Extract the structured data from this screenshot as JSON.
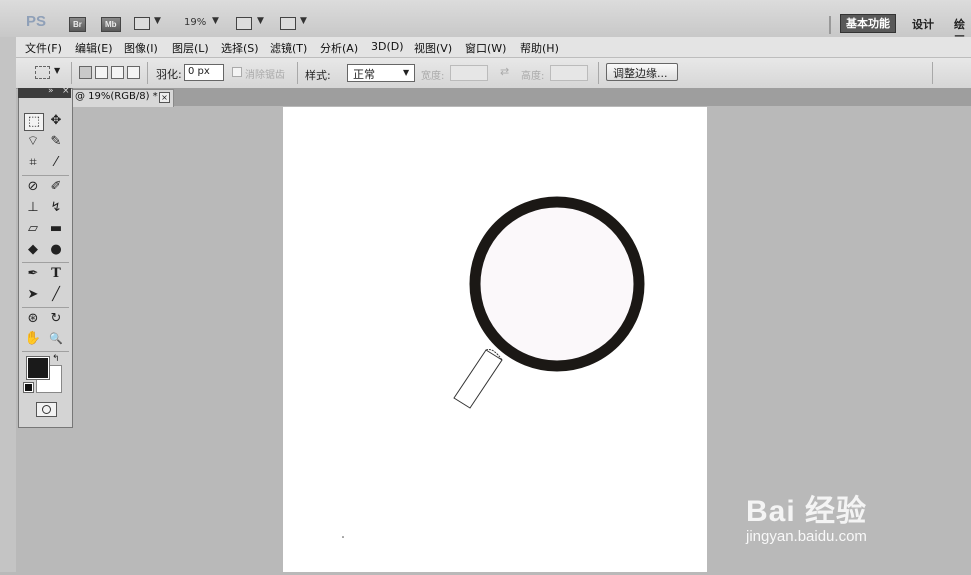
{
  "app": {
    "logo": "PS",
    "badges": [
      "Br",
      "Mb"
    ],
    "zoom": "19%"
  },
  "workspaces": [
    "基本功能",
    "设计",
    "绘画"
  ],
  "menu": [
    "文件(F)",
    "编辑(E)",
    "图像(I)",
    "图层(L)",
    "选择(S)",
    "滤镜(T)",
    "分析(A)",
    "3D(D)",
    "视图(V)",
    "窗口(W)",
    "帮助(H)"
  ],
  "options": {
    "feather_label": "羽化:",
    "feather_value": "0 px",
    "antialias_label": "消除锯齿",
    "style_label": "样式:",
    "style_value": "正常",
    "width_label": "宽度:",
    "height_label": "高度:",
    "refine_edge_button": "调整边缘..."
  },
  "document_tab": {
    "title": "@ 19%(RGB/8) *",
    "close": "×"
  },
  "toolbox": {
    "collapse": "»",
    "close": "×",
    "tools": [
      {
        "name": "rectangular-marquee-tool",
        "glyph": "⬚"
      },
      {
        "name": "move-tool",
        "glyph": "✥"
      },
      {
        "name": "lasso-tool",
        "glyph": "⌔"
      },
      {
        "name": "quick-selection-tool",
        "glyph": "✎"
      },
      {
        "name": "crop-tool",
        "glyph": "⌗"
      },
      {
        "name": "eyedropper-tool",
        "glyph": "⁄"
      },
      {
        "name": "spot-healing-tool",
        "glyph": "⊘"
      },
      {
        "name": "brush-tool",
        "glyph": "✐"
      },
      {
        "name": "clone-stamp-tool",
        "glyph": "⊥"
      },
      {
        "name": "history-brush-tool",
        "glyph": "↯"
      },
      {
        "name": "eraser-tool",
        "glyph": "▱"
      },
      {
        "name": "gradient-tool",
        "glyph": "▬"
      },
      {
        "name": "blur-tool",
        "glyph": "◆"
      },
      {
        "name": "dodge-tool",
        "glyph": "●"
      },
      {
        "name": "pen-tool",
        "glyph": "✒"
      },
      {
        "name": "type-tool",
        "glyph": "T"
      },
      {
        "name": "path-selection-tool",
        "glyph": "➤"
      },
      {
        "name": "line-tool",
        "glyph": "╱"
      },
      {
        "name": "3d-rotate-tool",
        "glyph": "⊛"
      },
      {
        "name": "3d-orbit-tool",
        "glyph": "↻"
      },
      {
        "name": "hand-tool",
        "glyph": "✋"
      },
      {
        "name": "zoom-tool",
        "glyph": "🔍"
      }
    ]
  },
  "colors": {
    "foreground": "#1a1a1a",
    "background": "#ffffff",
    "canvas": "#ffffff",
    "workspace": "#b9b9b9"
  },
  "watermark": {
    "line1": "Bai 经验",
    "line2": "jingyan.baidu.com"
  }
}
